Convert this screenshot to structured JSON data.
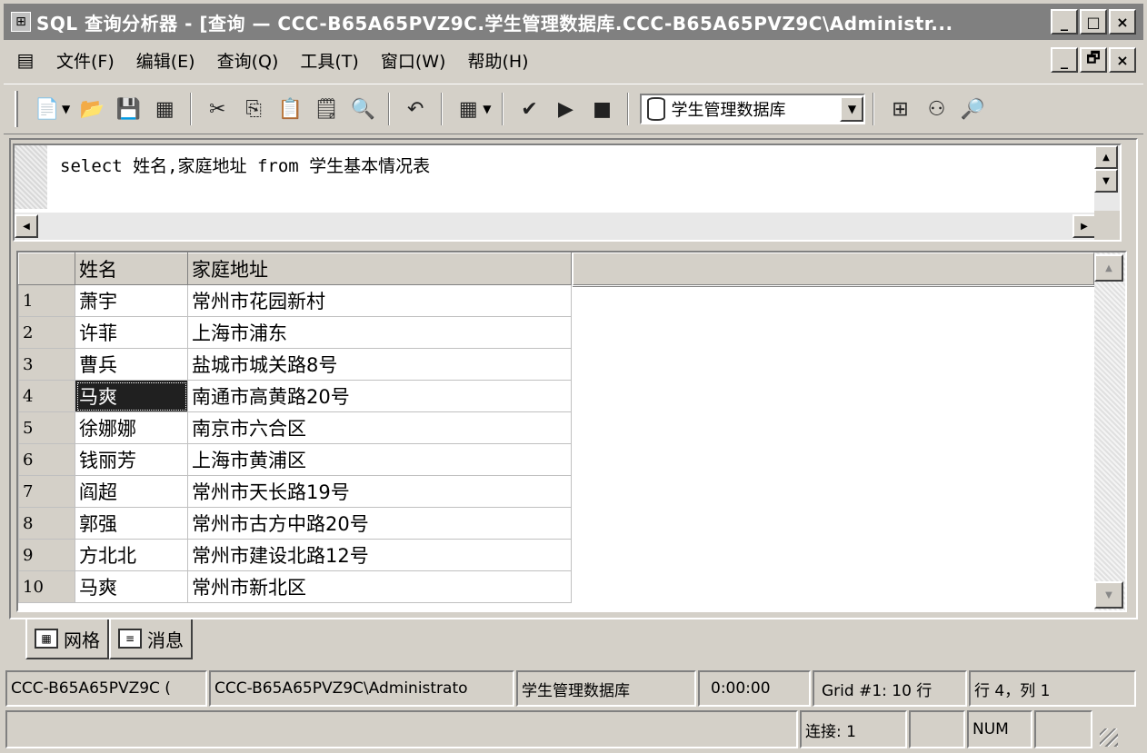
{
  "window": {
    "title": "SQL 查询分析器 - [查询 — CCC-B65A65PVZ9C.学生管理数据库.CCC-B65A65PVZ9C\\Administr...",
    "minimize": "_",
    "maximize": "□",
    "close": "×",
    "restore": "🗗"
  },
  "menu": {
    "items": [
      "文件(F)",
      "编辑(E)",
      "查询(Q)",
      "工具(T)",
      "窗口(W)",
      "帮助(H)"
    ]
  },
  "toolbar": {
    "database": "学生管理数据库"
  },
  "editor": {
    "query": "select 姓名,家庭地址 from 学生基本情况表"
  },
  "grid": {
    "columns": [
      "姓名",
      "家庭地址"
    ],
    "rows": [
      {
        "num": "1",
        "name": "萧宇",
        "addr": "常州市花园新村"
      },
      {
        "num": "2",
        "name": "许菲",
        "addr": "上海市浦东"
      },
      {
        "num": "3",
        "name": "曹兵",
        "addr": "盐城市城关路8号"
      },
      {
        "num": "4",
        "name": "马爽",
        "addr": "南通市高黄路20号"
      },
      {
        "num": "5",
        "name": "徐娜娜",
        "addr": "南京市六合区"
      },
      {
        "num": "6",
        "name": "钱丽芳",
        "addr": "上海市黄浦区"
      },
      {
        "num": "7",
        "name": "阎超",
        "addr": "常州市天长路19号"
      },
      {
        "num": "8",
        "name": "郭强",
        "addr": "常州市古方中路20号"
      },
      {
        "num": "9",
        "name": "方北北",
        "addr": "常州市建设北路12号"
      },
      {
        "num": "10",
        "name": "马爽",
        "addr": "常州市新北区"
      }
    ]
  },
  "tabs": {
    "grid": "网格",
    "messages": "消息"
  },
  "status": {
    "server": "CCC-B65A65PVZ9C (",
    "user": "CCC-B65A65PVZ9C\\Administrato",
    "database": "学生管理数据库",
    "time": "0:00:00",
    "rows": "Grid #1: 10 行",
    "position": "行 4，列 1",
    "connections": "连接: 1",
    "num": "NUM"
  }
}
